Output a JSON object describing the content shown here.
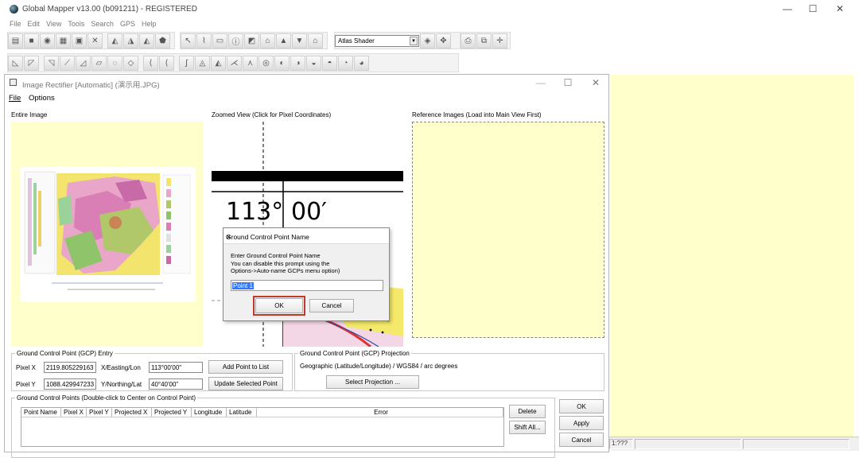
{
  "app": {
    "title": "Global Mapper v13.00 (b091211) - REGISTERED",
    "window_controls": {
      "minimize": "—",
      "maximize": "☐",
      "close": "✕"
    }
  },
  "menu": [
    "File",
    "Edit",
    "View",
    "Tools",
    "Search",
    "GPS",
    "Help"
  ],
  "toolbar": {
    "shader_label": "Atlas Shader",
    "row1_icons": [
      "open-icon",
      "stop-icon",
      "globe-icon",
      "layers-icon",
      "config-icon",
      "tools-icon",
      "pan-icon",
      "zoom-in-icon",
      "zoom-out-icon",
      "full-view-icon",
      "select-icon",
      "measure-icon",
      "digitize-icon",
      "info-icon",
      "path-profile-icon",
      "view-shed-icon",
      "3d-icon",
      "fly-icon"
    ],
    "row2_icons_count": 19
  },
  "dialog": {
    "title": "Image Rectifier [Automatic] (演示用.JPG)",
    "menu": [
      "File",
      "Options"
    ],
    "panels": {
      "entire_image": "Entire Image",
      "zoomed_view": "Zoomed View (Click for Pixel Coordinates)",
      "reference": "Reference Images (Load into Main View First)"
    },
    "zoom_text": {
      "deg": "113°",
      "min": "00′"
    },
    "gcp_entry": {
      "legend": "Ground Control Point (GCP) Entry",
      "pixel_x_label": "Pixel X",
      "pixel_x": "2119.805229163",
      "pixel_y_label": "Pixel Y",
      "pixel_y": "1088.429947233",
      "x_label": "X/Easting/Lon",
      "x_value": "113°00'00\"",
      "y_label": "Y/Northing/Lat",
      "y_value": "40°40'00\"",
      "add_btn": "Add Point to List",
      "update_btn": "Update Selected Point"
    },
    "projection": {
      "legend": "Ground Control Point (GCP) Projection",
      "text": "Geographic (Latitude/Longitude) / WGS84 / arc degrees",
      "select_btn": "Select Projection ..."
    },
    "points": {
      "legend": "Ground Control Points (Double-click to Center on Control Point)",
      "columns": [
        "Point Name",
        "Pixel X",
        "Pixel Y",
        "Projected X",
        "Projected Y",
        "Longitude",
        "Latitude",
        "Error"
      ],
      "delete_btn": "Delete",
      "shift_btn": "Shift All..."
    },
    "buttons": {
      "ok": "OK",
      "apply": "Apply",
      "cancel": "Cancel"
    }
  },
  "modal": {
    "title": "Ground Control Point Name",
    "message": "Enter Ground Control Point Name\nYou can disable this prompt using the\nOptions->Auto-name GCPs menu option)",
    "value": "Point 1",
    "ok": "OK",
    "cancel": "Cancel",
    "highlight_color": "#c0392b"
  },
  "status": {
    "coords": "1:???"
  }
}
